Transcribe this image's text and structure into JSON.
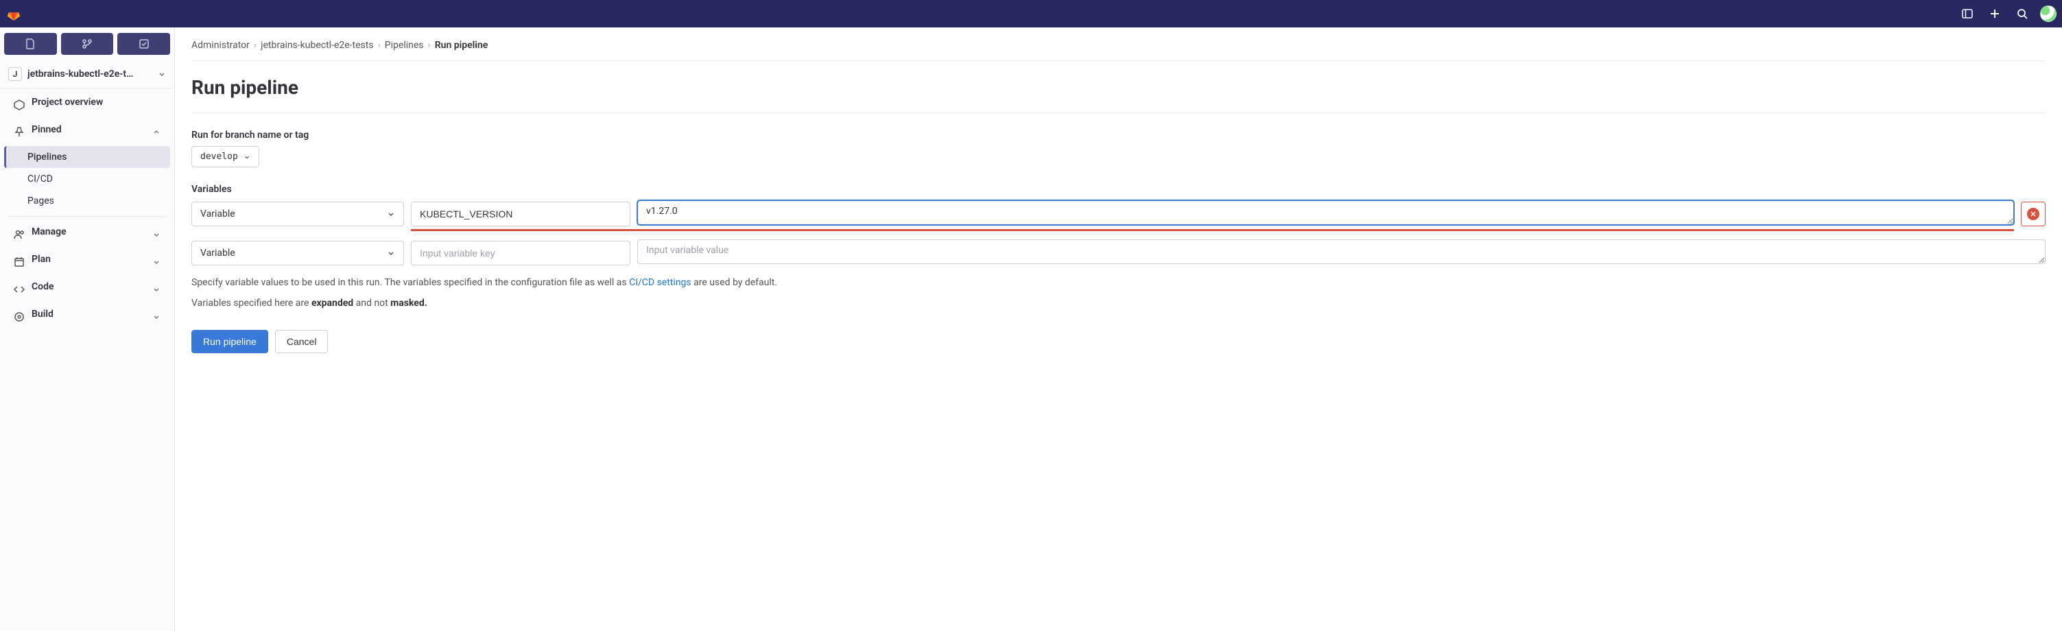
{
  "breadcrumb": {
    "items": [
      "Administrator",
      "jetbrains-kubectl-e2e-tests",
      "Pipelines",
      "Run pipeline"
    ]
  },
  "sidebar": {
    "project_initial": "J",
    "project_name": "jetbrains-kubectl-e2e-t…",
    "overview": "Project overview",
    "pinned": "Pinned",
    "pinned_items": [
      "Pipelines",
      "CI/CD",
      "Pages"
    ],
    "nav": [
      "Manage",
      "Plan",
      "Code",
      "Build"
    ]
  },
  "page": {
    "title": "Run pipeline",
    "branch_label": "Run for branch name or tag",
    "branch_value": "develop",
    "variables_label": "Variables",
    "type_label": "Variable",
    "rows": [
      {
        "key": "KUBECTL_VERSION",
        "value": "v1.27.0",
        "focused": true,
        "removable": true
      },
      {
        "key": "",
        "value": "",
        "focused": false,
        "removable": false
      }
    ],
    "key_placeholder": "Input variable key",
    "value_placeholder": "Input variable value",
    "help1_a": "Specify variable values to be used in this run. The variables specified in the configuration file as well as ",
    "help1_link": "CI/CD settings",
    "help1_b": " are used by default.",
    "help2_a": "Variables specified here are ",
    "help2_b1": "expanded",
    "help2_c": " and not ",
    "help2_b2": "masked.",
    "run_btn": "Run pipeline",
    "cancel_btn": "Cancel"
  }
}
